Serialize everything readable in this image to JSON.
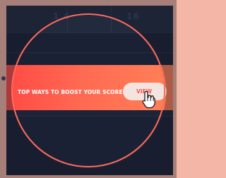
{
  "header": {
    "score_left": "1.4",
    "score_right": "16"
  },
  "banner": {
    "title": "TOP WAYS TO BOOST YOUR SCORE",
    "button_label": "VIEW"
  },
  "colors": {
    "accent": "#ff5246",
    "background": "#1e2437",
    "frame": "#f4b6a6",
    "ring": "#ff6b5c"
  },
  "icons": [
    "hand-pointer-icon"
  ]
}
